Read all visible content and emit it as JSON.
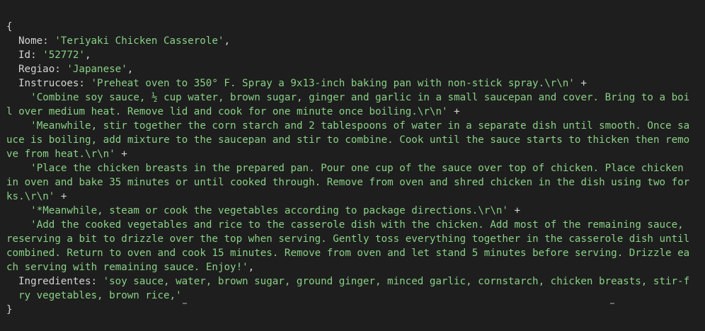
{
  "console": {
    "open_brace": "{",
    "close_brace": "}",
    "fields": {
      "nome": {
        "key": "Nome",
        "value": "'Teriyaki Chicken Casserole'"
      },
      "id": {
        "key": "Id",
        "value": "'52772'"
      },
      "regiao": {
        "key": "Regiao",
        "value": "'Japanese'"
      },
      "instrucoes": {
        "key": "Instrucoes",
        "parts": [
          "'Preheat oven to 350° F. Spray a 9x13-inch baking pan with non-stick spray.\\r\\n'",
          "'Combine soy sauce, ½ cup water, brown sugar, ginger and garlic in a small saucepan and cover. Bring to a boil over medium heat. Remove lid and cook for one minute once boiling.\\r\\n'",
          "'Meanwhile, stir together the corn starch and 2 tablespoons of water in a separate dish until smooth. Once sauce is boiling, add mixture to the saucepan and stir to combine. Cook until the sauce starts to thicken then remove from heat.\\r\\n'",
          "'Place the chicken breasts in the prepared pan. Pour one cup of the sauce over top of chicken. Place chicken in oven and bake 35 minutes or until cooked through. Remove from oven and shred chicken in the dish using two forks.\\r\\n'",
          "'*Meanwhile, steam or cook the vegetables according to package directions.\\r\\n'",
          "'Add the cooked vegetables and rice to the casserole dish with the chicken. Add most of the remaining sauce, reserving a bit to drizzle over the top when serving. Gently toss everything together in the casserole dish until combined. Return to oven and cook 15 minutes. Remove from oven and let stand 5 minutes before serving. Drizzle each serving with remaining sauce. Enjoy!'"
        ]
      },
      "ingredientes": {
        "key": "Ingredientes",
        "value": "'soy sauce, water, brown sugar, ground ginger, minced garlic, cornstarch, chicken breasts, stir-fry vegetables, brown rice,'"
      }
    },
    "tokens": {
      "colon": ": ",
      "comma": ",",
      "plus": " +"
    }
  },
  "colors": {
    "background": "#1e1e1e",
    "text": "#d4d4d4",
    "string": "#89d185"
  }
}
